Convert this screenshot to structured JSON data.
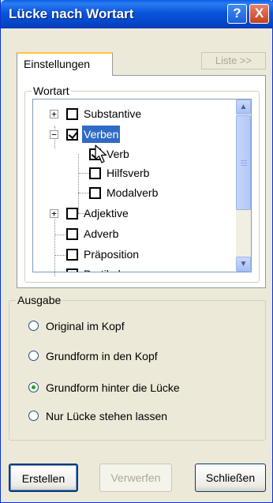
{
  "window": {
    "title": "Lücke nach Wortart",
    "help_label": "?",
    "close_label": "X"
  },
  "tabs": {
    "active_label": "Einstellungen",
    "inactive_label": "Liste >>"
  },
  "wortart": {
    "label": "Wortart",
    "items": [
      {
        "label": "Substantive",
        "checked": false,
        "expander": "+"
      },
      {
        "label": "Verben",
        "checked": true,
        "expander": "−",
        "selected": true
      },
      {
        "label": "Verb",
        "checked": true
      },
      {
        "label": "Hilfsverb",
        "checked": false
      },
      {
        "label": "Modalverb",
        "checked": false
      },
      {
        "label": "Adjektive",
        "checked": false,
        "expander": "+"
      },
      {
        "label": "Adverb",
        "checked": false
      },
      {
        "label": "Präposition",
        "checked": false
      },
      {
        "label": "Partikel",
        "checked": false
      }
    ]
  },
  "ausgabe": {
    "label": "Ausgabe",
    "options": [
      {
        "label": "Original im Kopf",
        "checked": false
      },
      {
        "label": "Grundform in den Kopf",
        "checked": false
      },
      {
        "label": "Grundform hinter die Lücke",
        "checked": true
      },
      {
        "label": "Nur Lücke stehen lassen",
        "checked": false
      }
    ]
  },
  "buttons": {
    "create": "Erstellen",
    "discard": "Verwerfen",
    "close": "Schließen"
  }
}
